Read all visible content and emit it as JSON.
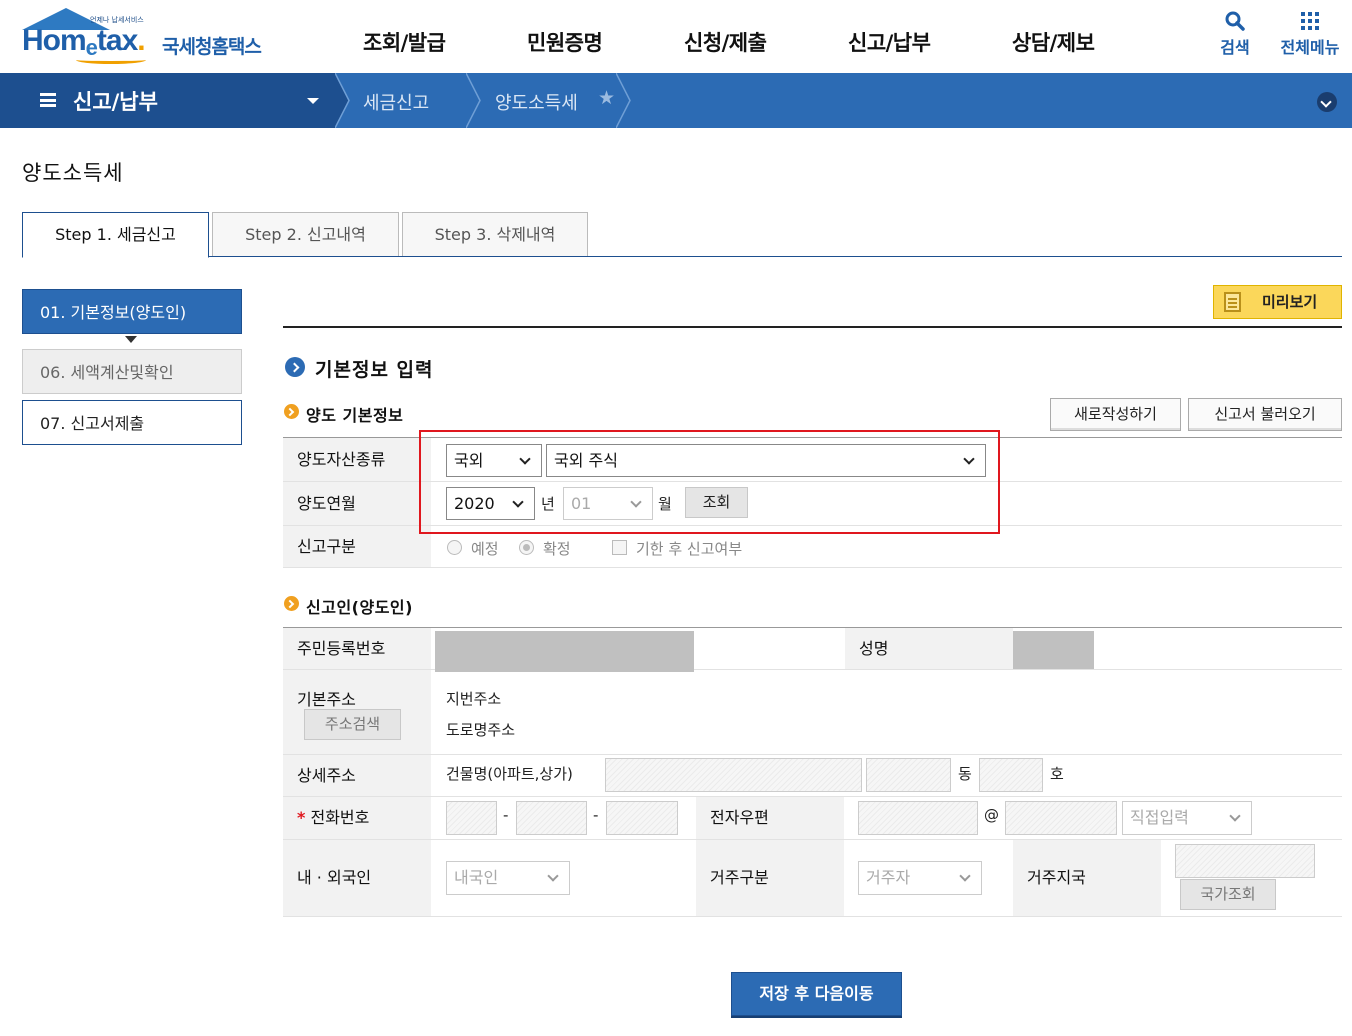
{
  "header": {
    "logo_slogan": "언제나 납세서비스",
    "logo_word": "Hometax",
    "logo_kr": "국세청홈택스",
    "gnb": [
      "조회/발급",
      "민원증명",
      "신청/제출",
      "신고/납부",
      "상담/제보"
    ],
    "search_label": "검색",
    "menu_label": "전체메뉴"
  },
  "location": {
    "main": "신고/납부",
    "crumb1": "세금신고",
    "crumb2": "양도소득세"
  },
  "page": {
    "title": "양도소득세",
    "tabs": [
      "Step 1. 세금신고",
      "Step 2. 신고내역",
      "Step 3. 삭제내역"
    ]
  },
  "steps": [
    "01. 기본정보(양도인)",
    "06. 세액계산및확인",
    "07. 신고서제출"
  ],
  "content": {
    "preview": "미리보기",
    "section_title": "기본정보 입력",
    "sub1": "양도 기본정보",
    "new_btn": "새로작성하기",
    "load_btn": "신고서 불러오기",
    "asset_label": "양도자산종류",
    "asset_sel1": "국외",
    "asset_sel2": "국외 주식",
    "ym_label": "양도연월",
    "year": "2020",
    "year_unit": "년",
    "month": "01",
    "month_unit": "월",
    "query_btn": "조회",
    "type_label": "신고구분",
    "radio1": "예정",
    "radio2": "확정",
    "check1": "기한 후 신고여부",
    "sub2": "신고인(양도인)",
    "rrn_label": "주민등록번호",
    "name_label": "성명",
    "addr_label": "기본주소",
    "addr_btn": "주소검색",
    "addr_jibun": "지번주소",
    "addr_road": "도로명주소",
    "detail_label": "상세주소",
    "building": "건물명(아파트,상가)",
    "dong": "동",
    "ho": "호",
    "phone_label": "전화번호",
    "phone_req": "*",
    "dash": "-",
    "email_label": "전자우편",
    "at": "@",
    "email_domain": "직접입력",
    "nat_label": "내 · 외국인",
    "nat_value": "내국인",
    "res_label": "거주구분",
    "res_value": "거주자",
    "country_label": "거주지국",
    "country_btn": "국가조회",
    "save": "저장 후 다음이동"
  }
}
